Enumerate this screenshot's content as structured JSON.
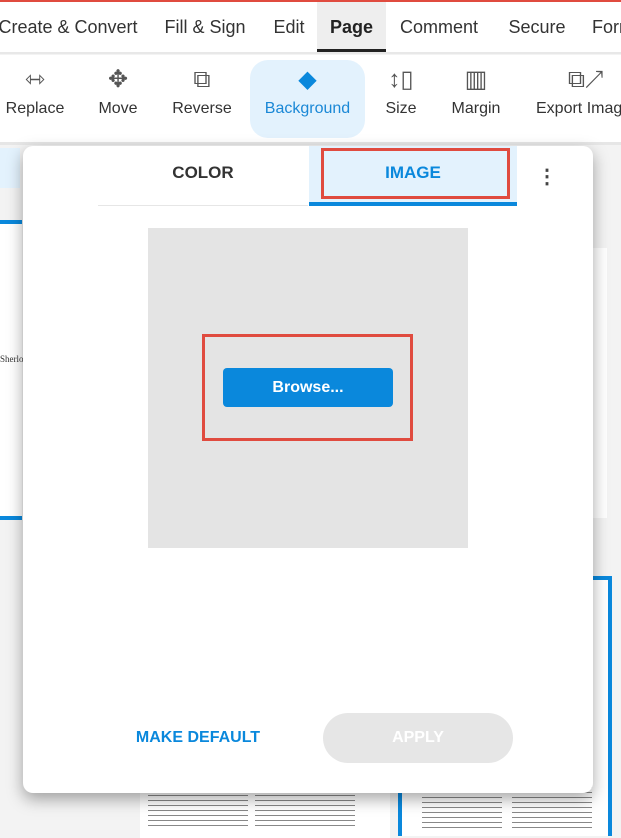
{
  "menu": {
    "tabs": [
      "Create & Convert",
      "Fill & Sign",
      "Edit",
      "Page",
      "Comment",
      "Secure",
      "Forr"
    ],
    "active": "Page"
  },
  "toolbar": {
    "items": [
      {
        "label": "Replace",
        "icon": "replace-icon"
      },
      {
        "label": "Move",
        "icon": "move-icon"
      },
      {
        "label": "Reverse",
        "icon": "reverse-icon"
      },
      {
        "label": "Background",
        "icon": "paint-bucket-icon"
      },
      {
        "label": "Size",
        "icon": "size-icon"
      },
      {
        "label": "Margin",
        "icon": "margin-icon"
      },
      {
        "label": "Export Imag",
        "icon": "export-image-icon"
      }
    ],
    "active": "Background"
  },
  "document": {
    "thumb_text": "Sherlo"
  },
  "dialog": {
    "tabs": [
      "COLOR",
      "IMAGE"
    ],
    "active_tab": "IMAGE",
    "browse_label": "Browse...",
    "make_default_label": "MAKE DEFAULT",
    "apply_label": "APPLY"
  },
  "colors": {
    "accent": "#0a88dc",
    "highlight": "#e04b3f",
    "active_bg": "#e3f2fd"
  }
}
